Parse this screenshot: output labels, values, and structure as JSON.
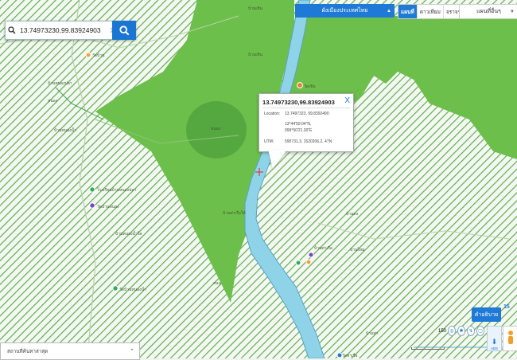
{
  "search": {
    "value": "13.74973230,99.83924903",
    "clear_label": "✕"
  },
  "toolbar": {
    "layer_label": "ผังเมืองประเทศไทย",
    "map_type": [
      "แผนที่",
      "ดาวเทียม",
      "จราจร"
    ],
    "other_maps_label": "แผนที่อื่นๆ"
  },
  "popup": {
    "title": "13.74973230,99.83924903",
    "location_label": "Location:",
    "location_value": "13.7497323, 99.8392490",
    "dms_lat": "13°44'59.04\"N,",
    "dms_lon": "099°50'21.30\"E",
    "utm_label": "UTM:",
    "utm_value": "590731.3, 1520206.2, 47N",
    "close_label": "X"
  },
  "place_labels": {
    "top_center": "บ้านเขิน",
    "upper_center": "บ้านเขิน",
    "temple": "วัดเขิน",
    "pond": "หนอง",
    "village_mid": "บ้านท่าเรือใต้",
    "left_marker": "วัดบ้าน",
    "left_a": "บ้านหนองปลา",
    "left_b": "หนอง",
    "left_c": "บ้านหนองน้ำ",
    "poi_1": "โรงเรียนบ้านหนองปลา",
    "poi_2": "วัดบ้านหนอง",
    "lower_left": "บ้านหนองน้ำใส",
    "poi_3": "วัดบ้านหนองน้ำ",
    "lower_mid": "บ้านท่าเรือ",
    "right_mid": "บ้านดง",
    "right_low": "บ้านใหม่",
    "road_label": "ถนน",
    "bottom_poi": "วัดท่าเรือ",
    "bottom_right": "บ้านท่า"
  },
  "bottom_panel": {
    "recent_label": "สถานที่ค้นหาล่าสุด",
    "toggle_icon": "chevron-up-icon"
  },
  "controls": {
    "legend_label": "คำอธิบาย",
    "zoom_level": "15",
    "street_view_label": "ABS",
    "scale_label": "150"
  },
  "colors": {
    "zone_green": "#6dbf4b",
    "hatch_green": "#58a94a",
    "river": "#8fd3e8",
    "accent_blue": "#1e7ad6"
  }
}
